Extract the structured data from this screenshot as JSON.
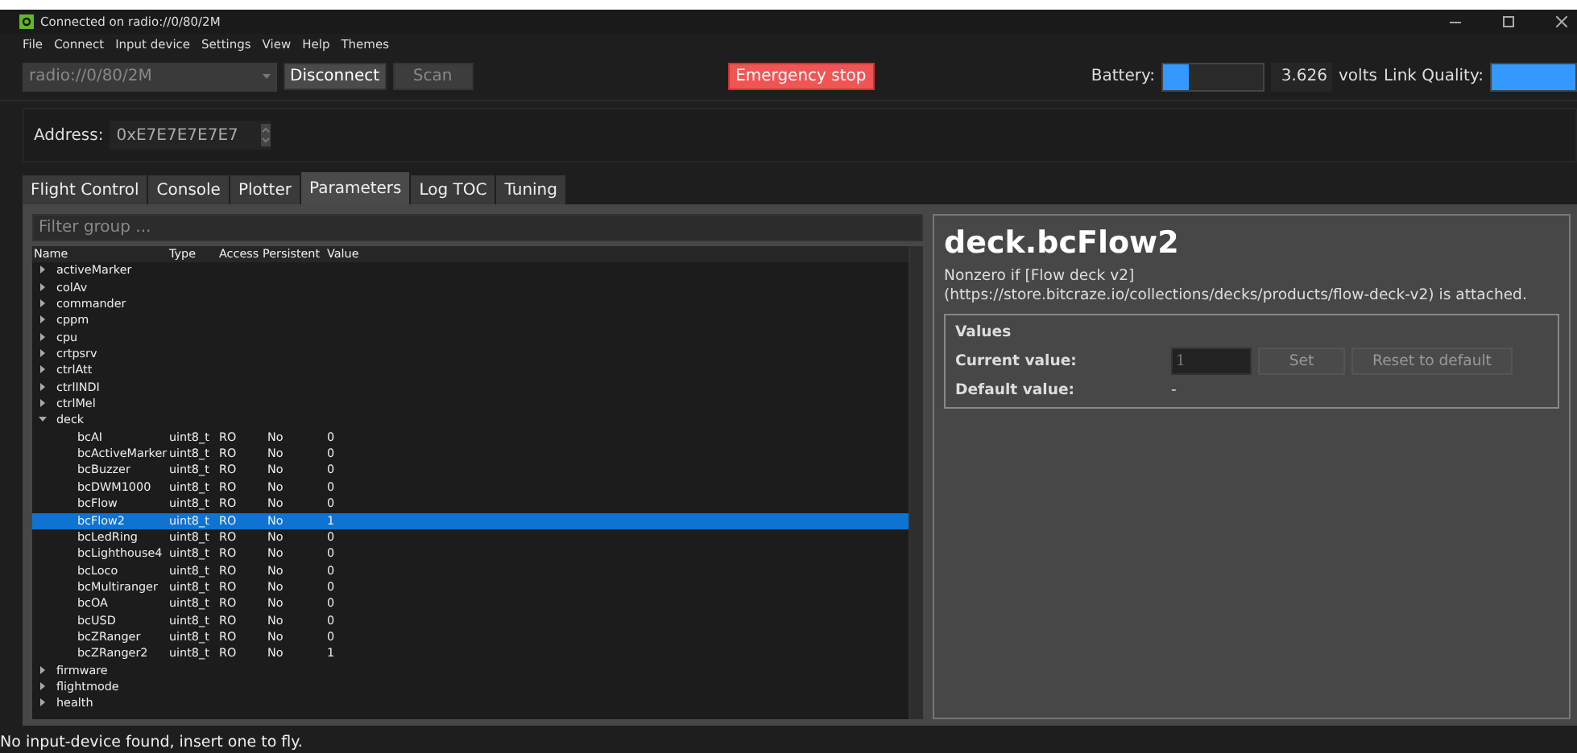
{
  "window": {
    "title": "Connected on radio://0/80/2M"
  },
  "menu": [
    "File",
    "Connect",
    "Input device",
    "Settings",
    "View",
    "Help",
    "Themes"
  ],
  "toolbar": {
    "uri": {
      "value": "radio://0/80/2M",
      "disabled": true
    },
    "buttons": [
      {
        "label": "Disconnect",
        "disabled": false
      },
      {
        "label": "Scan",
        "disabled": true
      }
    ],
    "emergency": "Emergency stop",
    "battery_label": "Battery:",
    "battery": {
      "level": 0.25
    },
    "voltage": "3.626",
    "voltage_unit": "volts",
    "link_label": "Link Quality:",
    "link": {
      "level": 1
    }
  },
  "address": {
    "label": "Address:",
    "value": "0xE7E7E7E7E7"
  },
  "tabs": [
    {
      "label": "Flight Control",
      "selected": false
    },
    {
      "label": "Console",
      "selected": false
    },
    {
      "label": "Plotter",
      "selected": false
    },
    {
      "label": "Parameters",
      "selected": true
    },
    {
      "label": "Log TOC",
      "selected": false
    },
    {
      "label": "Tuning",
      "selected": false
    }
  ],
  "filter": {
    "placeholder": "Filter group ..."
  },
  "tree": {
    "columns": [
      "Name",
      "Type",
      "Access",
      "Persistent",
      "Value"
    ],
    "groups": [
      {
        "name": "activeMarker",
        "expanded": false
      },
      {
        "name": "colAv",
        "expanded": false
      },
      {
        "name": "commander",
        "expanded": false
      },
      {
        "name": "cppm",
        "expanded": false
      },
      {
        "name": "cpu",
        "expanded": false
      },
      {
        "name": "crtpsrv",
        "expanded": false
      },
      {
        "name": "ctrlAtt",
        "expanded": false
      },
      {
        "name": "ctrlINDI",
        "expanded": false
      },
      {
        "name": "ctrlMel",
        "expanded": false
      },
      {
        "name": "deck",
        "expanded": true,
        "children": [
          {
            "name": "bcAI",
            "type": "uint8_t",
            "access": "RO",
            "persistent": "No",
            "value": "0",
            "selected": false
          },
          {
            "name": "bcActiveMarker",
            "type": "uint8_t",
            "access": "RO",
            "persistent": "No",
            "value": "0",
            "selected": false
          },
          {
            "name": "bcBuzzer",
            "type": "uint8_t",
            "access": "RO",
            "persistent": "No",
            "value": "0",
            "selected": false
          },
          {
            "name": "bcDWM1000",
            "type": "uint8_t",
            "access": "RO",
            "persistent": "No",
            "value": "0",
            "selected": false
          },
          {
            "name": "bcFlow",
            "type": "uint8_t",
            "access": "RO",
            "persistent": "No",
            "value": "0",
            "selected": false
          },
          {
            "name": "bcFlow2",
            "type": "uint8_t",
            "access": "RO",
            "persistent": "No",
            "value": "1",
            "selected": true
          },
          {
            "name": "bcLedRing",
            "type": "uint8_t",
            "access": "RO",
            "persistent": "No",
            "value": "0",
            "selected": false
          },
          {
            "name": "bcLighthouse4",
            "type": "uint8_t",
            "access": "RO",
            "persistent": "No",
            "value": "0",
            "selected": false
          },
          {
            "name": "bcLoco",
            "type": "uint8_t",
            "access": "RO",
            "persistent": "No",
            "value": "0",
            "selected": false
          },
          {
            "name": "bcMultiranger",
            "type": "uint8_t",
            "access": "RO",
            "persistent": "No",
            "value": "0",
            "selected": false
          },
          {
            "name": "bcOA",
            "type": "uint8_t",
            "access": "RO",
            "persistent": "No",
            "value": "0",
            "selected": false
          },
          {
            "name": "bcUSD",
            "type": "uint8_t",
            "access": "RO",
            "persistent": "No",
            "value": "0",
            "selected": false
          },
          {
            "name": "bcZRanger",
            "type": "uint8_t",
            "access": "RO",
            "persistent": "No",
            "value": "0",
            "selected": false
          },
          {
            "name": "bcZRanger2",
            "type": "uint8_t",
            "access": "RO",
            "persistent": "No",
            "value": "1",
            "selected": false
          }
        ]
      },
      {
        "name": "firmware",
        "expanded": false
      },
      {
        "name": "flightmode",
        "expanded": false
      },
      {
        "name": "health",
        "expanded": false
      }
    ]
  },
  "detail": {
    "title": "deck.bcFlow2",
    "description": "Nonzero if [Flow deck v2](https://store.bitcraze.io/collections/decks/products/flow-deck-v2) is attached.",
    "values": {
      "heading": "Values",
      "current_label": "Current value:",
      "current_value": "1",
      "set": "Set",
      "reset": "Reset to default",
      "default_label": "Default value:",
      "default_value": "-"
    }
  },
  "status_bar": "No input-device found, insert one to fly."
}
